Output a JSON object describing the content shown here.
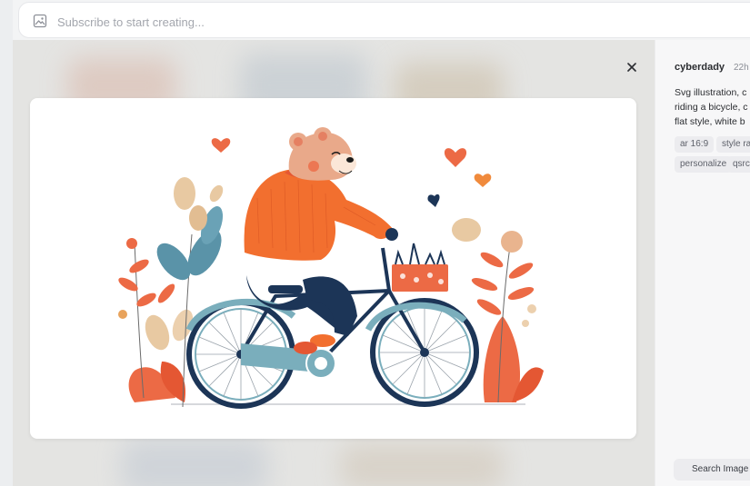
{
  "search": {
    "placeholder": "Subscribe to start creating..."
  },
  "icons": {
    "prompt_icon": "image-icon",
    "close": "close-icon"
  },
  "post": {
    "author": "cyberdady",
    "time": "22h",
    "prompt_lines": [
      "Svg illustration, c",
      "riding a bicycle, c",
      "flat style, white b"
    ],
    "chips": [
      "ar 16:9",
      "style ra",
      "personalize",
      "qsrc"
    ]
  },
  "actions": {
    "search_image": "Search Image"
  },
  "colors": {
    "sweater": "#f26f2f",
    "pants": "#1c3557",
    "bike": "#7aaebc",
    "leaf_red": "#ec6a45",
    "leaf_blue": "#5a93a8",
    "leaf_beige": "#e8c9a2"
  }
}
